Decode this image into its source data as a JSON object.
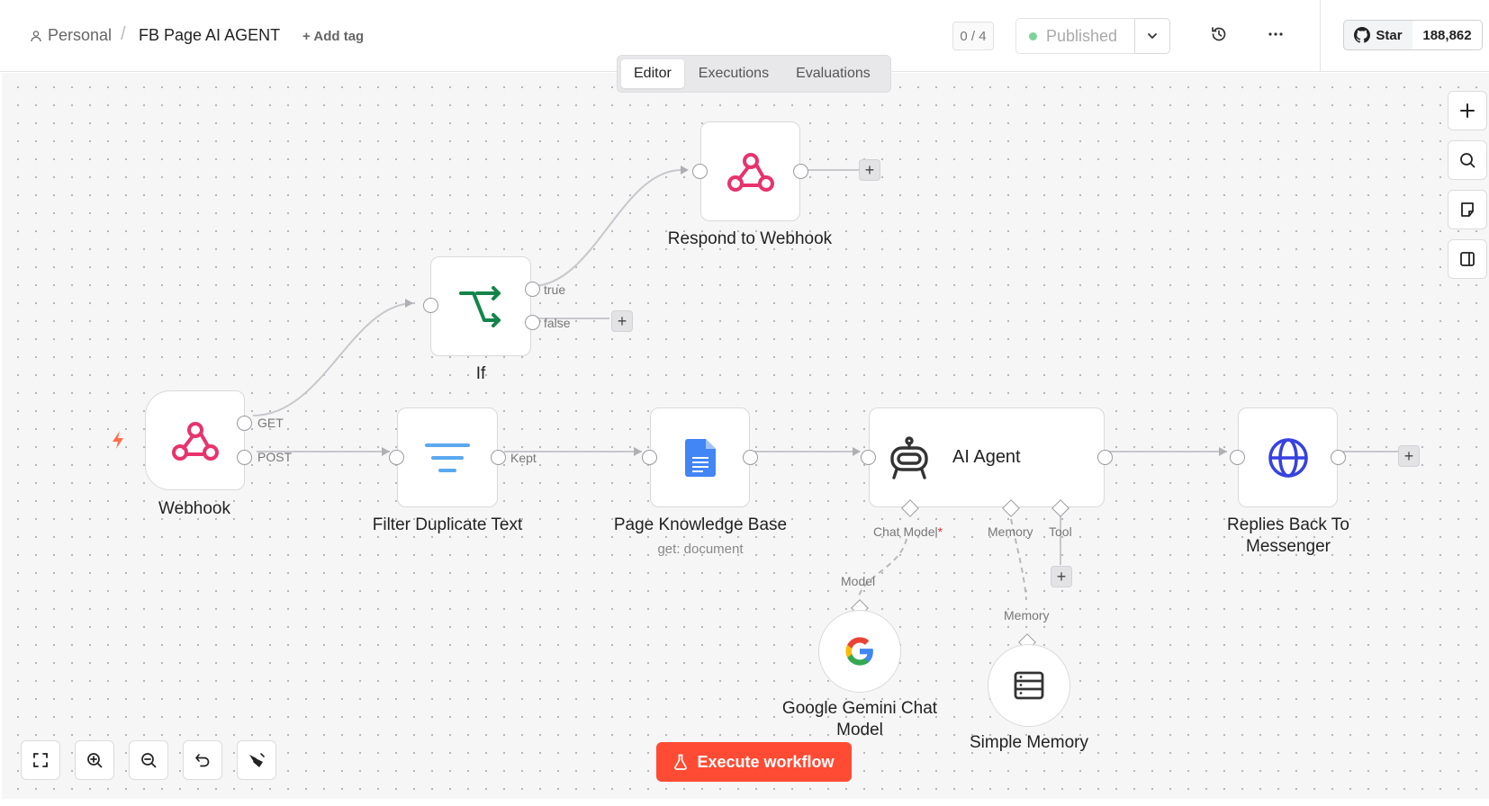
{
  "header": {
    "breadcrumb_personal": "Personal",
    "separator": "/",
    "workflow_title": "FB Page AI AGENT",
    "add_tag": "+ Add tag",
    "counter": "0 / 4",
    "publish_status": "Published",
    "github_star": "Star",
    "github_count": "188,862"
  },
  "tabs": [
    {
      "label": "Editor",
      "active": true
    },
    {
      "label": "Executions",
      "active": false
    },
    {
      "label": "Evaluations",
      "active": false
    }
  ],
  "nodes": {
    "webhook": {
      "label": "Webhook",
      "out_get": "GET",
      "out_post": "POST"
    },
    "if": {
      "label": "If",
      "out_true": "true",
      "out_false": "false"
    },
    "respond": {
      "label": "Respond to Webhook"
    },
    "filter": {
      "label": "Filter Duplicate Text",
      "out_kept": "Kept"
    },
    "knowledge": {
      "label": "Page Knowledge Base",
      "subtitle": "get: document"
    },
    "agent": {
      "label": "AI Agent",
      "port_chat_model": "Chat Model",
      "required_mark": "*",
      "port_memory": "Memory",
      "port_tool": "Tool"
    },
    "replies": {
      "label_line1": "Replies Back To",
      "label_line2": "Messenger"
    },
    "gemini": {
      "label_line1": "Google Gemini Chat",
      "label_line2": "Model",
      "port": "Model"
    },
    "memory": {
      "label": "Simple Memory",
      "port": "Memory"
    }
  },
  "execute_button": "Execute workflow",
  "icons": {
    "webhook": "webhook-icon",
    "if": "branch-icon",
    "filter": "filter-lines-icon",
    "docs": "google-docs-icon",
    "agent": "robot-icon",
    "http": "globe-icon",
    "gemini": "google-g-icon",
    "memory": "database-icon"
  },
  "colors": {
    "accent": "#ff4b33",
    "webhook": "#e8336c",
    "if": "#13854a",
    "filter": "#5aa8ee",
    "docs": "#4285f4",
    "globe": "#3742e0",
    "published_dot": "#7ed39b"
  }
}
